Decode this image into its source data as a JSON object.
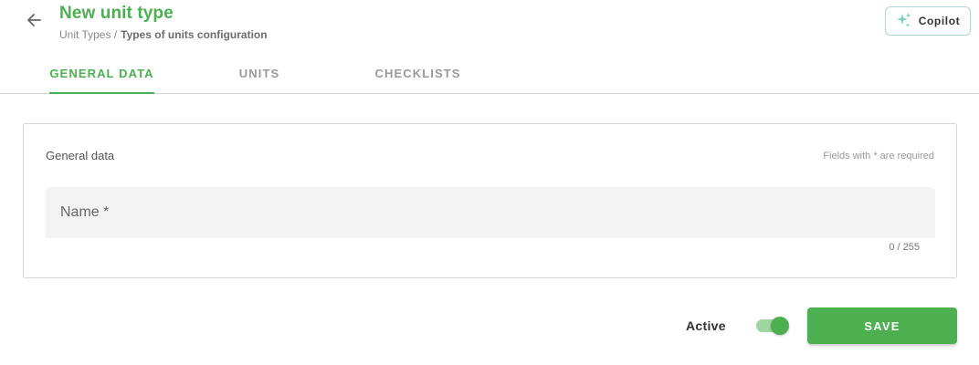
{
  "header": {
    "title": "New unit type",
    "breadcrumb": {
      "parent": "Unit Types /",
      "current": "Types of units configuration"
    },
    "back_icon": "arrow-left-icon",
    "copilot": {
      "label": "Copilot",
      "icon": "sparkle-icon",
      "icon_color": "#7fd0c0"
    }
  },
  "tabs": [
    {
      "label": "GENERAL DATA",
      "active": true
    },
    {
      "label": "UNITS",
      "active": false
    },
    {
      "label": "CHECKLISTS",
      "active": false
    }
  ],
  "card": {
    "title": "General data",
    "required_note": "Fields with * are required",
    "name_field": {
      "placeholder": "Name *",
      "value": "",
      "counter": "0 / 255"
    }
  },
  "footer": {
    "active_label": "Active",
    "active_on": true,
    "save_label": "SAVE"
  },
  "colors": {
    "accent": "#4caf50",
    "copilot_border": "#a8d8d8"
  }
}
